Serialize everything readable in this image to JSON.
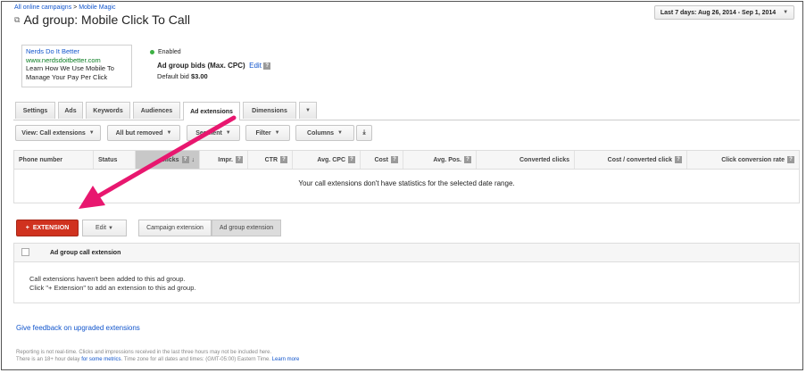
{
  "breadcrumb": {
    "campaigns_link": "All online campaigns",
    "sep": ">",
    "campaign_link": "Mobile Magic"
  },
  "title": "Ad group: Mobile Click To Call",
  "date_range": {
    "label": "Last 7 days: Aug 26, 2014 - Sep 1, 2014"
  },
  "ad_preview": {
    "headline": "Nerds Do It Better",
    "url": "www.nerdsdoitbetter.com",
    "line1": "Learn How We Use Mobile To",
    "line2": "Manage Your Pay Per Click"
  },
  "status": {
    "label": "Enabled",
    "color": "#3cb043"
  },
  "bids": {
    "label": "Ad group bids (Max. CPC)",
    "edit": "Edit",
    "default_label": "Default bid",
    "default_value": "$3.00"
  },
  "tabs": [
    {
      "label": "Settings"
    },
    {
      "label": "Ads"
    },
    {
      "label": "Keywords"
    },
    {
      "label": "Audiences"
    },
    {
      "label": "Ad extensions",
      "active": true
    },
    {
      "label": "Dimensions"
    }
  ],
  "toolbar": {
    "view": "View: Call extensions",
    "filter_removed": "All but removed",
    "segment": "Segment",
    "filter": "Filter",
    "columns": "Columns"
  },
  "grid": {
    "columns": [
      "Phone number",
      "Status",
      "Clicks",
      "Impr.",
      "CTR",
      "Avg. CPC",
      "Cost",
      "Avg. Pos.",
      "Converted clicks",
      "Cost / converted click",
      "Click conversion rate"
    ],
    "empty_message": "Your call extensions don't have statistics for the selected date range."
  },
  "actions": {
    "extension_button": "EXTENSION",
    "edit_button": "Edit",
    "segment_campaign": "Campaign extension",
    "segment_adgroup": "Ad group extension"
  },
  "ext_table": {
    "header": "Ad group call extension",
    "empty_line1": "Call extensions haven't been added to this ad group.",
    "empty_line2": "Click \"+ Extension\" to add an extension to this ad group."
  },
  "feedback_link": "Give feedback on upgraded extensions",
  "footer": {
    "line1": "Reporting is not real-time. Clicks and impressions received in the last three hours may not be included here.",
    "line2_a": "There is an 18+ hour delay",
    "line2_link1": "for some metrics",
    "line2_b": ". Time zone for all dates and times: (GMT-05:00) Eastern Time.",
    "line2_link2": "Learn more"
  },
  "colors": {
    "accent_red": "#d0321f",
    "link": "#1155cc",
    "arrow": "#e8176f"
  }
}
